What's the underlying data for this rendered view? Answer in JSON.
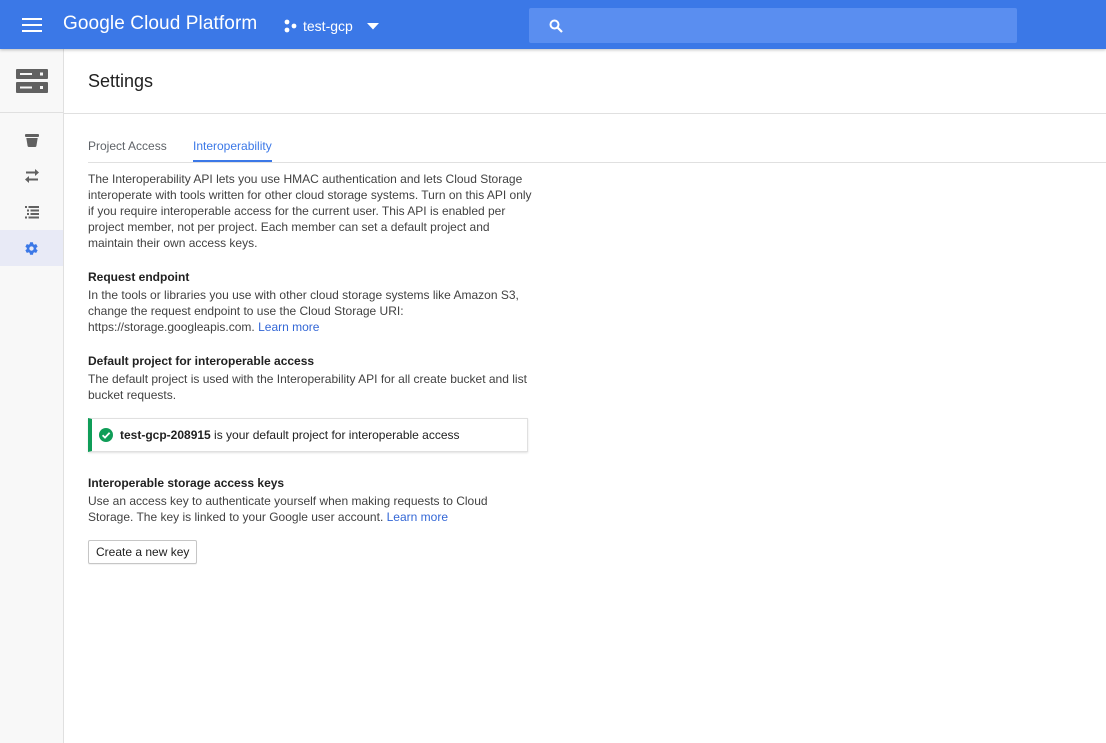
{
  "topbar": {
    "brand": "Google Cloud Platform",
    "project_name": "test-gcp",
    "search_placeholder": "",
    "color": "#3b78e7"
  },
  "leftnav": {
    "product_icon": "storage-icon",
    "items": [
      {
        "icon": "bucket-icon",
        "active": false
      },
      {
        "icon": "transfer-icon",
        "active": false
      },
      {
        "icon": "list-icon",
        "active": false
      },
      {
        "icon": "gear-icon",
        "active": true
      }
    ]
  },
  "header": {
    "title": "Settings"
  },
  "tabs": [
    {
      "label": "Project Access",
      "active": false
    },
    {
      "label": "Interoperability",
      "active": true
    }
  ],
  "intro": "The Interoperability API lets you use HMAC authentication and lets Cloud Storage interoperate with tools written for other cloud storage systems. Turn on this API only if you require interoperable access for the current user. This API is enabled per project member, not per project. Each member can set a default project and maintain their own access keys.",
  "request_endpoint": {
    "heading": "Request endpoint",
    "text": "In the tools or libraries you use with other cloud storage systems like Amazon S3, change the request endpoint to use the Cloud Storage URI: https://storage.googleapis.com.",
    "link": "Learn more"
  },
  "default_project": {
    "heading": "Default project for interoperable access",
    "text": "The default project is used with the Interoperability API for all create bucket and list bucket requests.",
    "notice_project": "test-gcp-208915",
    "notice_text": " is your default project for interoperable access",
    "notice_color": "#0f9d58"
  },
  "access_keys": {
    "heading": "Interoperable storage access keys",
    "text": "Use an access key to authenticate yourself when making requests to Cloud Storage. The key is linked to your Google user account.",
    "link": "Learn more",
    "button": "Create a new key"
  }
}
